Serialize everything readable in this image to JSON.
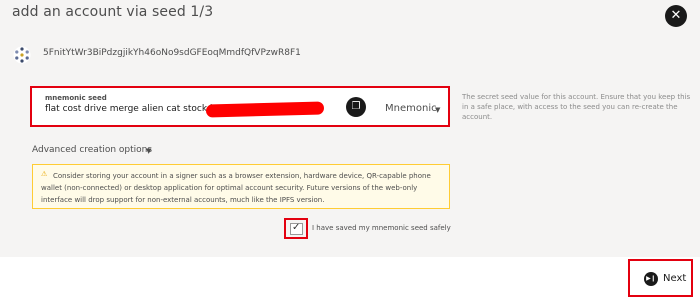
{
  "modal": {
    "title": "add an account via seed 1/3",
    "close_icon": "close-icon"
  },
  "account": {
    "address": "5FnitYtWr3BiPdzgjikYh46oNo9sdGFEoqMmdfQfVPzwR8F1"
  },
  "seed": {
    "label": "mnemonic seed",
    "value": "flat cost drive merge alien cat stock love",
    "redaction_color": "#ff0000",
    "copy_icon": "copy-icon",
    "type_selected": "Mnemonic",
    "help_text": "The secret seed value for this account. Ensure that you keep this in a safe place, with access to the seed you can re-create the account."
  },
  "advanced": {
    "label": "Advanced creation options"
  },
  "warning": {
    "text": "Consider storing your account in a signer such as a browser extension, hardware device, QR-capable phone wallet (non-connected) or desktop application for optimal account security. Future versions of the web-only interface will drop support for non-external accounts, much like the IPFS version."
  },
  "confirm": {
    "checked": true,
    "label": "I have saved my mnemonic seed safely"
  },
  "footer": {
    "next_label": "Next"
  },
  "colors": {
    "highlight": "#e3000f",
    "warning_border": "#ffcc33",
    "warning_bg": "#fffbe8",
    "dark": "#1a1a1a"
  }
}
